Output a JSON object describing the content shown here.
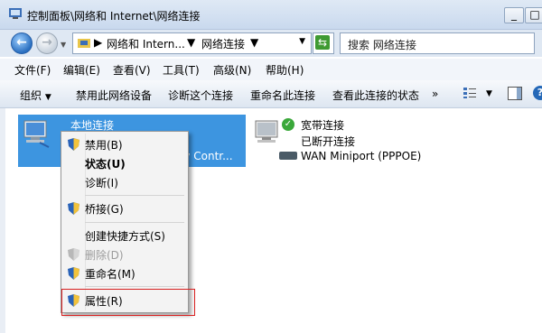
{
  "window": {
    "title": "控制面板\\网络和 Internet\\网络连接",
    "buttons": {
      "minimize": "_",
      "maximize": "□"
    }
  },
  "address": {
    "crumbs": [
      "网络和 Intern...",
      "网络连接"
    ],
    "search_placeholder": "搜索 网络连接"
  },
  "menubar": [
    "文件(F)",
    "编辑(E)",
    "查看(V)",
    "工具(T)",
    "高级(N)",
    "帮助(H)"
  ],
  "toolbar": {
    "items": [
      "组织",
      "禁用此网络设备",
      "诊断这个连接",
      "重命名此连接",
      "查看此连接的状态"
    ],
    "more": "»",
    "help": "?"
  },
  "connections": {
    "local": {
      "name": "本地连接",
      "device_partial": "ly Contr..."
    },
    "broadband": {
      "name": "宽带连接",
      "status": "已断开连接",
      "device": "WAN Miniport (PPPOE)"
    }
  },
  "context_menu": {
    "items": [
      {
        "label": "禁用(B)",
        "icon": "shield-icon",
        "bold": false,
        "disabled": false
      },
      {
        "label": "状态(U)",
        "icon": "",
        "bold": true,
        "disabled": false
      },
      {
        "label": "诊断(I)",
        "icon": "",
        "bold": false,
        "disabled": false
      },
      {
        "label": "桥接(G)",
        "icon": "shield-icon",
        "bold": false,
        "disabled": false
      },
      {
        "label": "创建快捷方式(S)",
        "icon": "",
        "bold": false,
        "disabled": false
      },
      {
        "label": "删除(D)",
        "icon": "shield-icon",
        "bold": false,
        "disabled": true
      },
      {
        "label": "重命名(M)",
        "icon": "shield-icon",
        "bold": false,
        "disabled": false
      },
      {
        "label": "属性(R)",
        "icon": "shield-icon",
        "bold": false,
        "disabled": false
      }
    ],
    "highlight_color": "#d82020"
  },
  "colors": {
    "selection": "#3d95e0",
    "status_ok": "#3aa83a"
  }
}
